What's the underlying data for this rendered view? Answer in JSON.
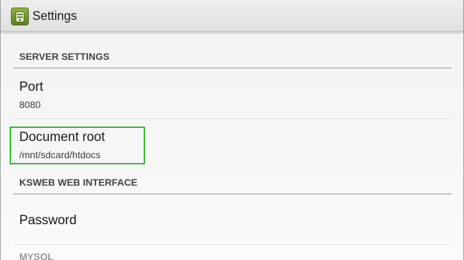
{
  "action_bar": {
    "title": "Settings",
    "app_icon": "ksweb-app-icon"
  },
  "sections": {
    "server": {
      "header": "SERVER SETTINGS",
      "port": {
        "title": "Port",
        "summary": "8080"
      },
      "document_root": {
        "title": "Document root",
        "summary": "/mnt/sdcard/htdocs"
      }
    },
    "ksweb": {
      "header": "KSWEB WEB INTERFACE",
      "password": {
        "title": "Password"
      }
    },
    "mysql": {
      "header": "MYSQL"
    }
  },
  "colors": {
    "highlight": "#2eb82e",
    "app_icon": "#6e9330"
  }
}
